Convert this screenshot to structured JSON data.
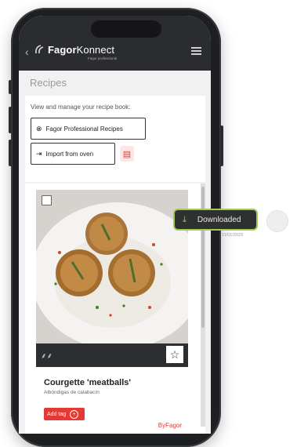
{
  "app": {
    "brand_bold": "Fagor",
    "brand_light": "Konnect",
    "brand_sub": "Fagor professional",
    "back_glyph": "‹"
  },
  "page": {
    "title": "Recipes",
    "description": "View and manage your recipe book:",
    "buttons": {
      "pro_recipes": "Fagor Professional Recipes",
      "import_from_oven": "Import from oven"
    }
  },
  "recipe": {
    "title": "Courgette 'meatballs'",
    "subtitle": "Albóndigas de calabacín",
    "add_tag": "Add tag",
    "source": "ByFagor",
    "favorite_glyph": "☆"
  },
  "toast": {
    "label": "Downloaded",
    "note": "11/01/2023"
  },
  "icons": {
    "pro_recipes": "chef-icon",
    "import": "import-icon",
    "book": "book-icon",
    "download": "download-icon",
    "diet": "vegetable-icon",
    "favorite": "star-icon"
  },
  "colors": {
    "appbar": "#2b2c2f",
    "accent_red": "#e53935",
    "toast_border": "#9ccd58"
  }
}
